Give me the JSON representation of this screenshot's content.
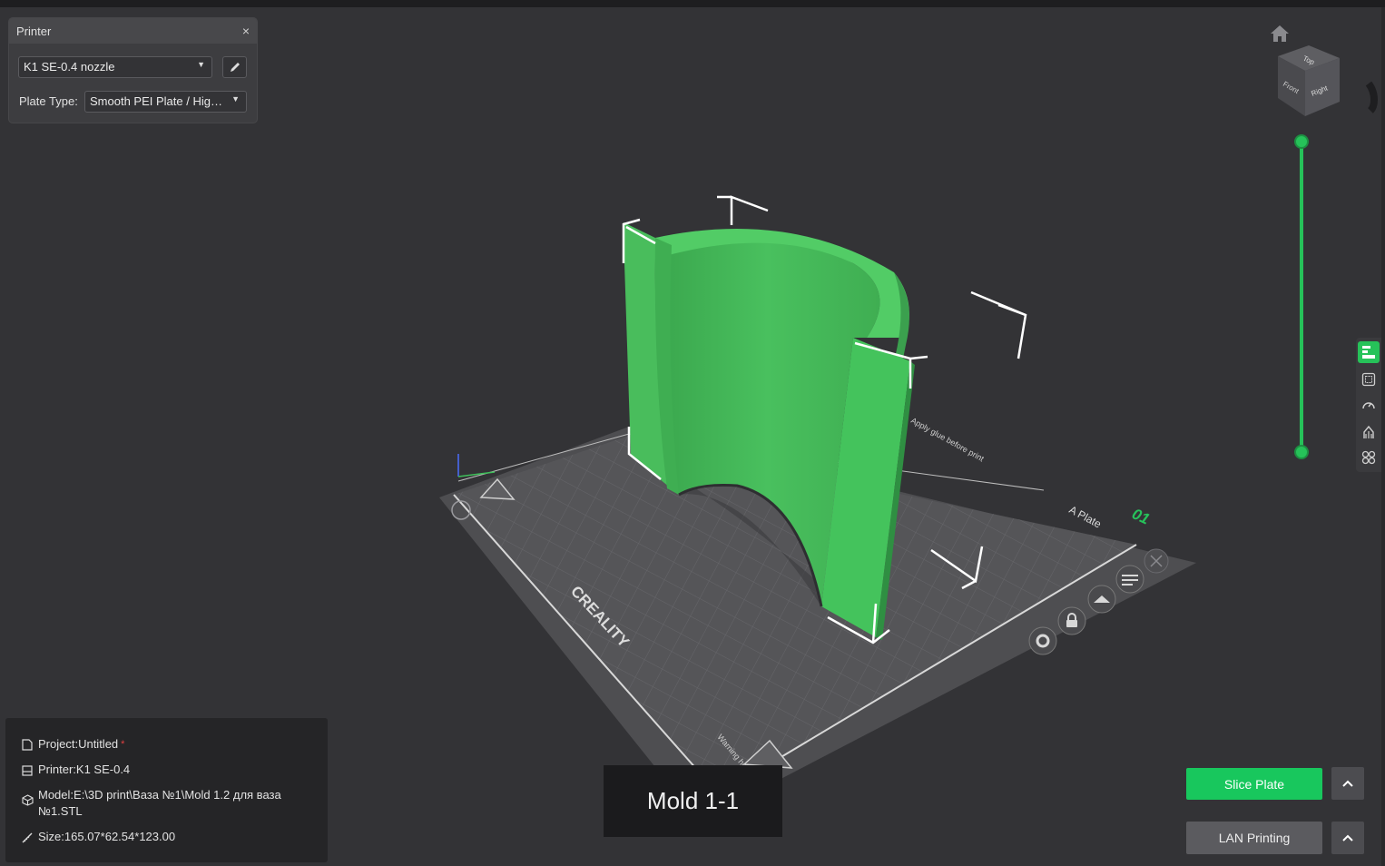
{
  "colors": {
    "accent": "#18c75d",
    "model_green": "#44c35c",
    "background": "#333336",
    "bed": "#545457"
  },
  "printer_panel": {
    "title": "Printer",
    "close_glyph": "×",
    "printer_select": "K1 SE-0.4 nozzle",
    "plate_type_label": "Plate Type:",
    "plate_type_select": "Smooth PEI Plate / Hig…"
  },
  "viewcube": {
    "top": "Top",
    "front": "Front",
    "right": "Right"
  },
  "bed": {
    "brand": "CREALITY",
    "plate_name": "A Plate",
    "plate_number": "01",
    "notice_right": "Apply glue before print",
    "warning_text": "Warning hot surface"
  },
  "info": {
    "project": "Project:Untitled",
    "modified_marker": "*",
    "printer": "Printer:K1 SE-0.4",
    "model_line1": "Model:E:\\3D print\\Ваза №1\\Mold 1.2 для ваза",
    "model_line2": "№1.STL",
    "size": "Size:165.07*62.54*123.00"
  },
  "model_label": "Mold 1-1",
  "buttons": {
    "slice_plate": "Slice Plate",
    "lan_printing": "LAN Printing"
  }
}
